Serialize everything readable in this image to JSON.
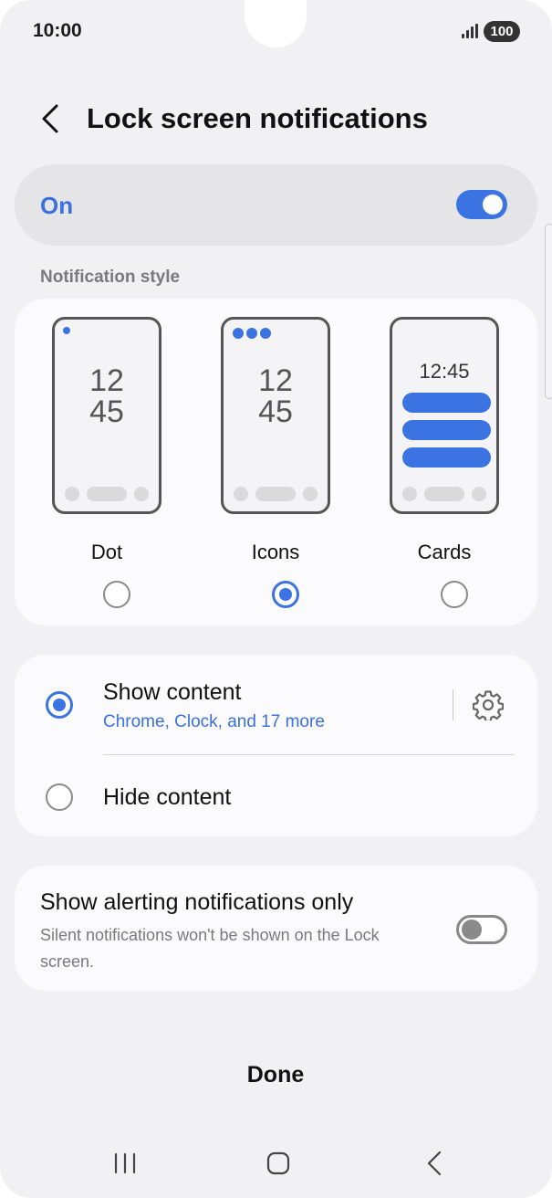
{
  "status_bar": {
    "time": "10:00",
    "battery": "100"
  },
  "header": {
    "title": "Lock screen notifications"
  },
  "master": {
    "label": "On",
    "enabled": true
  },
  "notification_style": {
    "section_label": "Notification style",
    "options": [
      {
        "label": "Dot",
        "selected": false,
        "preview_clock": [
          "12",
          "45"
        ]
      },
      {
        "label": "Icons",
        "selected": true,
        "preview_clock": [
          "12",
          "45"
        ]
      },
      {
        "label": "Cards",
        "selected": false,
        "preview_clock": "12:45"
      }
    ]
  },
  "content": {
    "show": {
      "label": "Show content",
      "sub": "Chrome, Clock, and 17 more",
      "selected": true
    },
    "hide": {
      "label": "Hide content",
      "selected": false
    }
  },
  "alerting": {
    "title": "Show alerting notifications only",
    "description": "Silent notifications won't be shown on the Lock screen.",
    "enabled": false
  },
  "footer": {
    "done_label": "Done"
  },
  "colors": {
    "accent": "#3b73e3",
    "background": "#f1f1f3",
    "card": "#fbfbfd"
  },
  "icons": [
    "back-icon",
    "gear-icon",
    "signal-icon",
    "battery-icon",
    "recents-icon",
    "home-icon",
    "nav-back-icon"
  ]
}
